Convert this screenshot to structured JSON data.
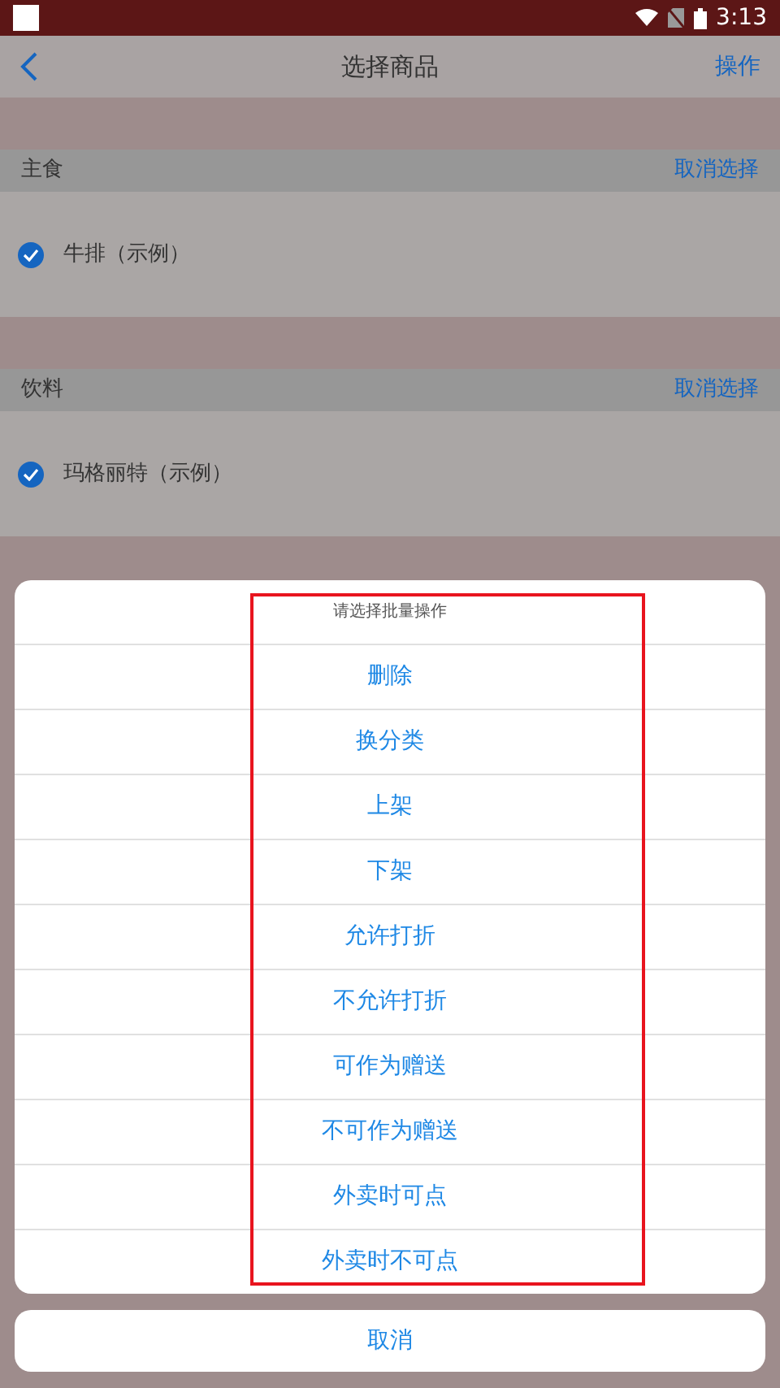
{
  "status_bar": {
    "time": "3:13"
  },
  "nav": {
    "title": "选择商品",
    "action": "操作"
  },
  "sections": [
    {
      "title": "主食",
      "action": "取消选择",
      "items": [
        {
          "label": "牛排（示例）",
          "checked": true
        }
      ]
    },
    {
      "title": "饮料",
      "action": "取消选择",
      "items": [
        {
          "label": "玛格丽特（示例）",
          "checked": true
        }
      ]
    }
  ],
  "action_sheet": {
    "title": "请选择批量操作",
    "options": [
      "删除",
      "换分类",
      "上架",
      "下架",
      "允许打折",
      "不允许打折",
      "可作为赠送",
      "不可作为赠送",
      "外卖时可点",
      "外卖时不可点"
    ],
    "cancel": "取消"
  }
}
